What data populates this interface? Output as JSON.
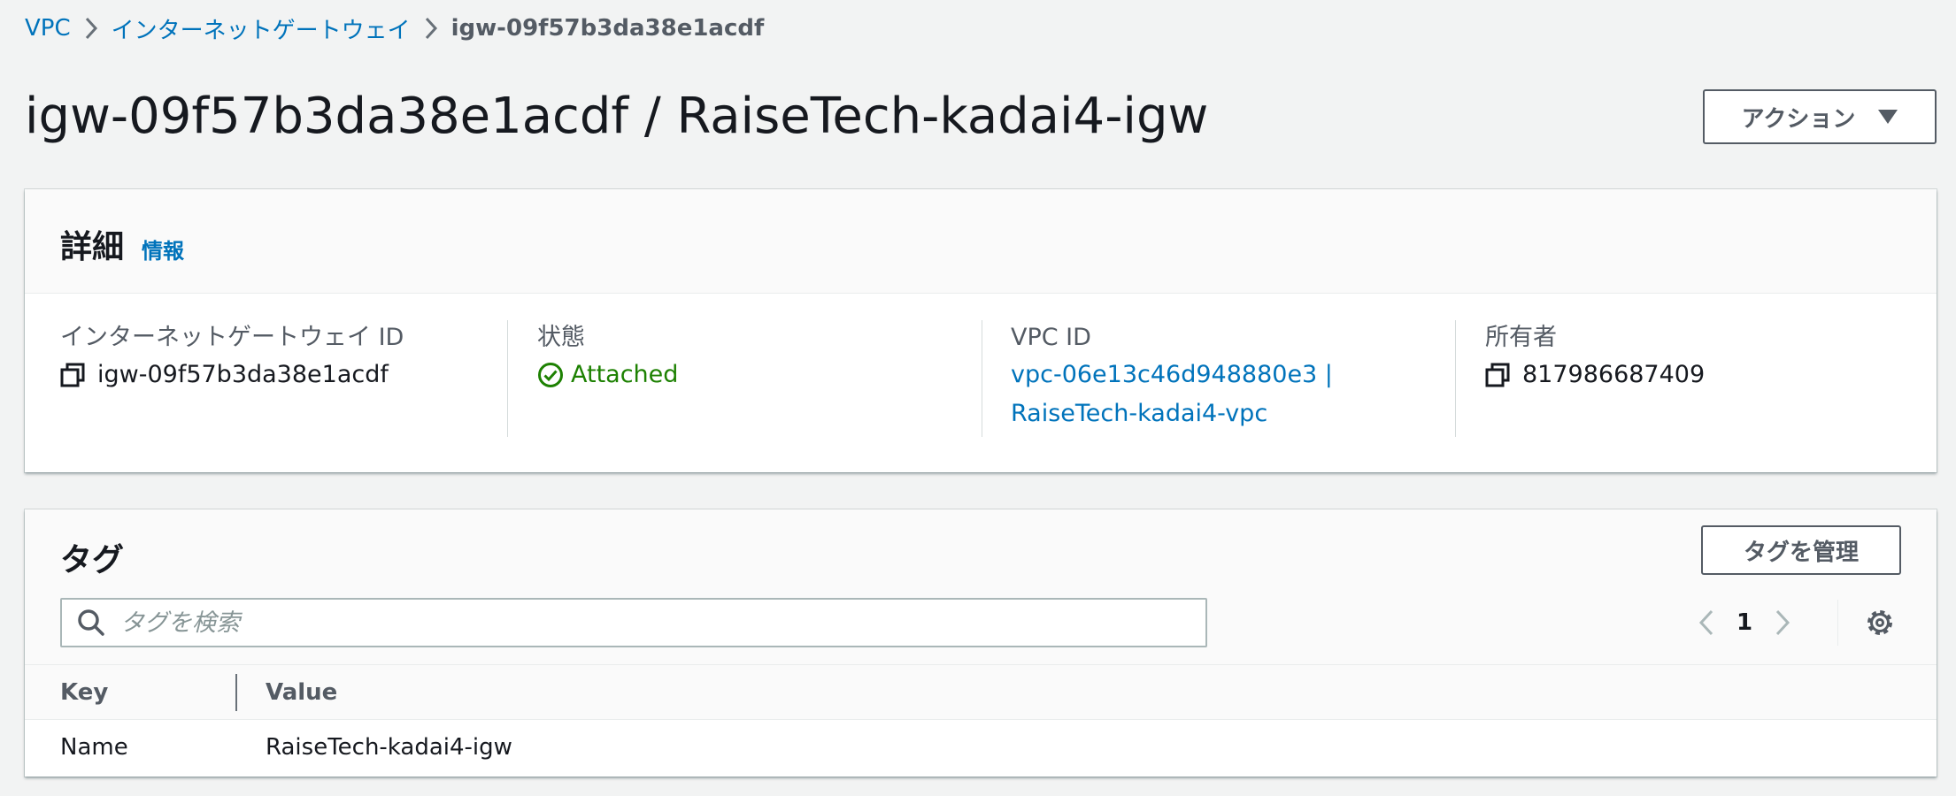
{
  "breadcrumb": {
    "items": [
      "VPC",
      "インターネットゲートウェイ"
    ],
    "current": "igw-09f57b3da38e1acdf"
  },
  "header": {
    "title": "igw-09f57b3da38e1acdf / RaiseTech-kadai4-igw",
    "actions_label": "アクション"
  },
  "details": {
    "title": "詳細",
    "info_label": "情報",
    "columns": [
      {
        "label": "インターネットゲートウェイ ID",
        "value": "igw-09f57b3da38e1acdf"
      },
      {
        "label": "状態",
        "value": "Attached"
      },
      {
        "label": "VPC ID",
        "value_line1": "vpc-06e13c46d948880e3 |",
        "value_line2": "RaiseTech-kadai4-vpc"
      },
      {
        "label": "所有者",
        "value": "817986687409"
      }
    ]
  },
  "tags": {
    "title": "タグ",
    "manage_label": "タグを管理",
    "search_placeholder": "タグを検索",
    "page": "1",
    "columns": [
      "Key",
      "Value"
    ],
    "rows": [
      {
        "key": "Name",
        "value": "RaiseTech-kadai4-igw"
      }
    ]
  },
  "colors": {
    "link": "#0073bb",
    "success": "#1d8102",
    "background": "#f2f3f3"
  }
}
